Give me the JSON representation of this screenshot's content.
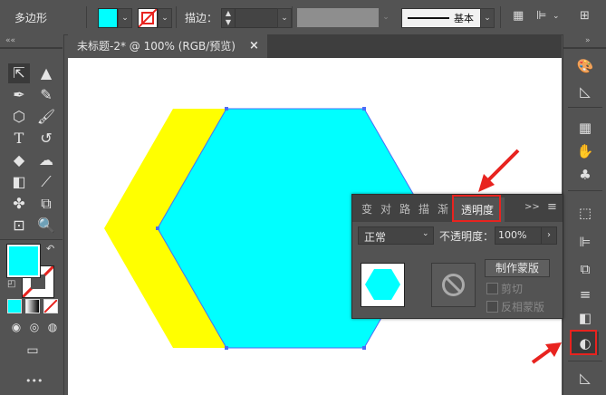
{
  "control_bar": {
    "tool_name": "多边形",
    "stroke_label": "描边：",
    "stroke_style": "基本"
  },
  "document": {
    "tab_title": "未标题-2* @ 100% (RGB/预览)",
    "close_glyph": "×"
  },
  "transparency_panel": {
    "tabs": [
      "变",
      "对",
      "路",
      "描",
      "渐"
    ],
    "active_tab": "透明度",
    "blend_mode": "正常",
    "opacity_label": "不透明度：",
    "opacity_value": "100%",
    "make_mask_button": "制作蒙版",
    "clip_label": "剪切",
    "invert_mask_label": "反相蒙版",
    "overflow_glyph": ">>",
    "menu_glyph": "≡"
  },
  "colors": {
    "fill": "#00ffff",
    "yellow_shape": "#ffff00",
    "selection": "#4a6cf7",
    "highlight": "#e8231f"
  },
  "toolbar_more": "•••"
}
